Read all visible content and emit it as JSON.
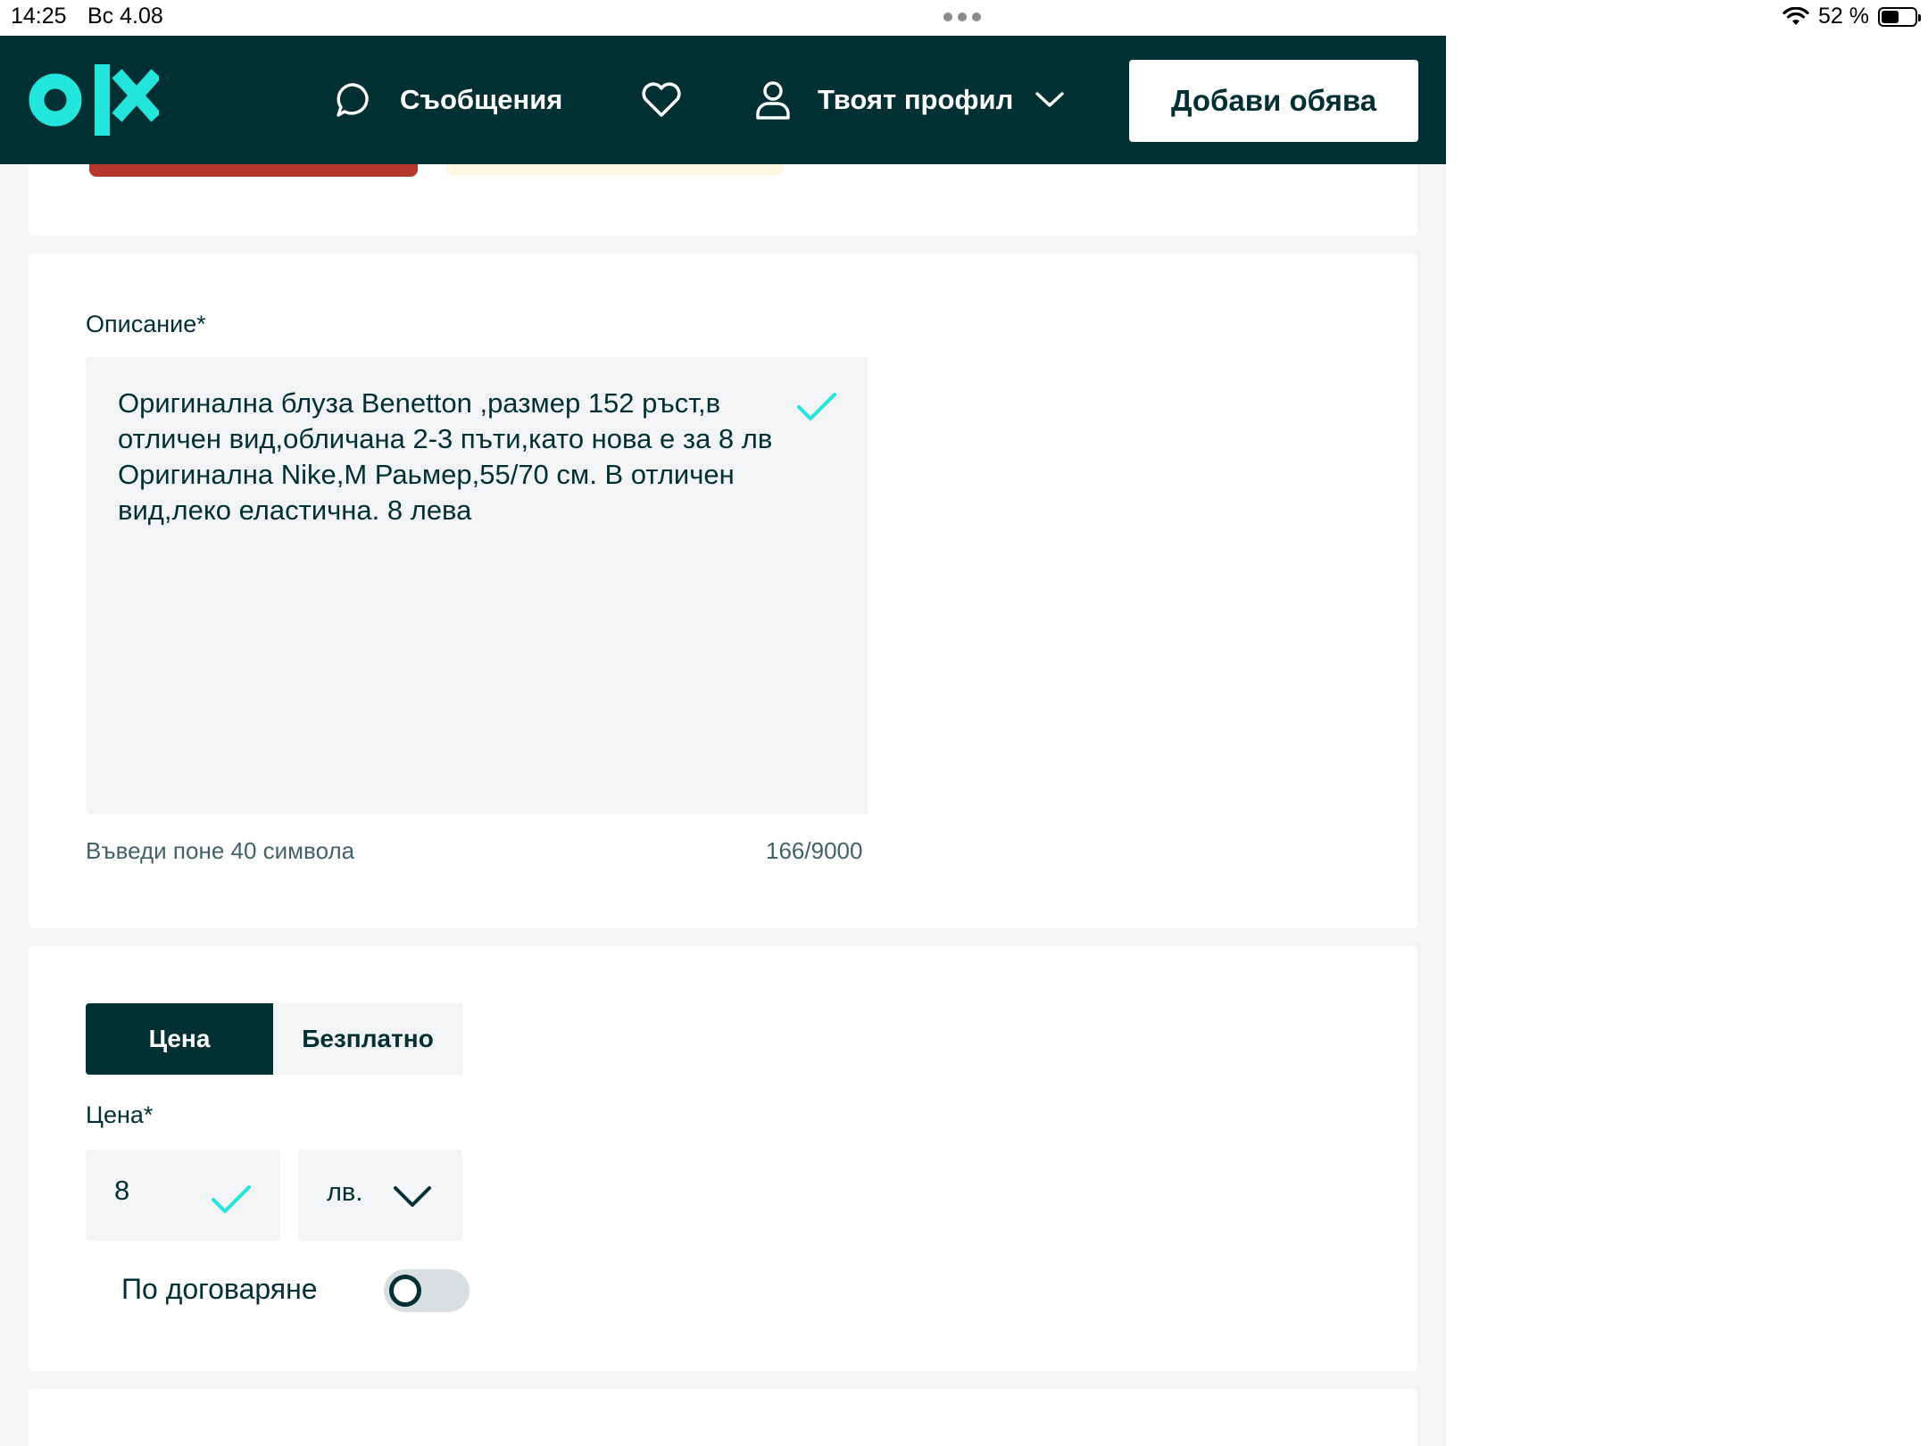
{
  "status_bar": {
    "time": "14:25",
    "date": "Вс 4.08",
    "battery": "52 %",
    "battery_level": 0.52
  },
  "header": {
    "logo_text": "olx",
    "messages_label": "Съобщения",
    "profile_label": "Твоят профил",
    "add_button": "Добави обява",
    "colors": {
      "background": "#002f34",
      "logo": "#23e5db",
      "button": "#ffffff"
    }
  },
  "description": {
    "label": "Описание*",
    "value": "Оригинална блуза Benetton ,размер 152 ръст,в отличен вид,обличана 2-3 пъти,като нова е за 8 лв\nОригинална Nike,M Раьмер,55/70 см. В отличен вид,леко еластична. 8 лева",
    "hint": "Въведи поне 40 символа",
    "counter": "166/9000"
  },
  "price": {
    "tabs": [
      {
        "label": "Цена",
        "active": true
      },
      {
        "label": "Безплатно",
        "active": false
      }
    ],
    "label": "Цена*",
    "value": "8",
    "currency": "лв.",
    "negotiable_label": "По договаряне",
    "negotiable": false,
    "check_color": "#23e5db"
  }
}
